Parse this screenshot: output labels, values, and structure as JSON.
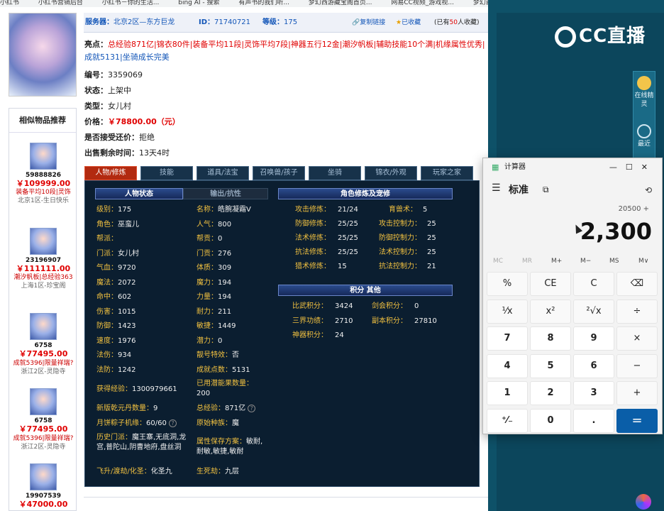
{
  "browser": {
    "tabs": [
      "小红书",
      "小红书营销后台",
      "小红书－你的生活...",
      "bing AI - 搜索",
      "有声书的我们听...",
      "梦幻西游藏宝阁首页...",
      "网易CC视频_游戏视...",
      "梦幻西游藏宝阁"
    ]
  },
  "product": {
    "server_label": "服务器：",
    "server": "北京2区—东方巨龙",
    "id_label": "ID：",
    "id": "71740721",
    "level_label": "等级：",
    "level": "175",
    "copy_link": "复制链接",
    "favorited": "已收藏",
    "fav_prefix": "(已有",
    "fav_count": "50",
    "fav_suffix": "人收藏)",
    "highlights_label": "亮点：",
    "highlights_line1": "总经验871亿|锦衣80件|装备平均11段|灵饰平均7段|神器五行12金|潮汐帆板|辅助技能10个满|机缘属性优秀|",
    "highlights_line2": "成就5131|坐骑成长完美",
    "number_label": "编号：",
    "number": "3359069",
    "status_label": "状态：",
    "status": "上架中",
    "type_label": "类型：",
    "type": "女儿村",
    "price_label": "价格：",
    "price": "￥78800.00（元）",
    "bargain_label": "是否接受还价：",
    "bargain": "拒绝",
    "remaining_label": "出售剩余时间：",
    "remaining": "13天4时"
  },
  "recommend": {
    "title": "相似物品推荐",
    "items": [
      {
        "id": "59888826",
        "price": "￥109999.00",
        "tag": "装备平均10段|灵饰",
        "server": "北京1区-生日快乐"
      },
      {
        "id": "23196907",
        "price": "￥111111.00",
        "tag": "潮汐帆板|总经验363",
        "server": "上海1区-珍宝阁"
      },
      {
        "id": "6758",
        "price": "￥77495.00",
        "tag": "成就5396|限量祥瑞?",
        "server": "浙江2区-灵隐寺"
      },
      {
        "id": "6758",
        "price": "￥77495.00",
        "tag": "成就5396|限量祥瑞?",
        "server": "浙江2区-灵隐寺"
      },
      {
        "id": "19907539",
        "price": "￥47000.00",
        "tag": "",
        "server": ""
      }
    ]
  },
  "tabs": [
    "人物/修炼",
    "技能",
    "道具/法宝",
    "召唤兽/孩子",
    "坐骑",
    "锦衣/外观",
    "玩家之家"
  ],
  "panel": {
    "char_status": "人物状态",
    "output_resist": "输出/抗性",
    "cultivation": "角色修炼及宠修",
    "points_other": "积分 其他",
    "left_fields": [
      {
        "k": "级别：",
        "v": "175"
      },
      {
        "k": "角色：",
        "v": "巫蛮儿"
      },
      {
        "k": "帮派：",
        "v": ""
      },
      {
        "k": "门派：",
        "v": "女儿村"
      },
      {
        "k": "气血：",
        "v": "9720"
      },
      {
        "k": "魔法：",
        "v": "2072"
      },
      {
        "k": "命中：",
        "v": "602"
      },
      {
        "k": "伤害：",
        "v": "1015"
      },
      {
        "k": "防御：",
        "v": "1423"
      },
      {
        "k": "速度：",
        "v": "1976"
      },
      {
        "k": "法伤：",
        "v": "934"
      },
      {
        "k": "法防：",
        "v": "1242"
      }
    ],
    "mid_fields": [
      {
        "k": "名称：",
        "v": "皓腕凝霜V"
      },
      {
        "k": "人气：",
        "v": "800"
      },
      {
        "k": "帮贡：",
        "v": "0"
      },
      {
        "k": "门贡：",
        "v": "276"
      },
      {
        "k": "体质：",
        "v": "309"
      },
      {
        "k": "魔力：",
        "v": "194"
      },
      {
        "k": "力量：",
        "v": "194"
      },
      {
        "k": "耐力：",
        "v": "211"
      },
      {
        "k": "敏捷：",
        "v": "1449"
      },
      {
        "k": "潜力：",
        "v": "0"
      },
      {
        "k": "靓号特效：",
        "v": "否"
      },
      {
        "k": "成就点数：",
        "v": "5131"
      }
    ],
    "exp_label": "获得经验：",
    "exp": "1300979661",
    "potential_label": "已用潜能果数量：",
    "potential": "200",
    "qiankun_label": "新版乾元丹数量：",
    "qiankun": "9",
    "total_exp_label": "总经验：",
    "total_exp": "871亿",
    "moon_label": "月饼粽子机缘：",
    "moon": "60/60",
    "race_label": "原始种族：",
    "race": "魔",
    "history_label": "历史门派：",
    "history": "魔王寨,无底洞,龙宫,普陀山,阴曹地府,盘丝洞",
    "attr_label": "属性保存方案：",
    "attr": "敏耐,耐敏,敏捷,敏耐",
    "fly_label": "飞升/渡劫/化圣：",
    "fly": "化圣九",
    "life_label": "生死劫：",
    "life": "九层",
    "cult_rows": [
      {
        "a": "攻击修炼：",
        "av": "21/24",
        "b": "育兽术：",
        "bv": "5"
      },
      {
        "a": "防御修炼：",
        "av": "25/25",
        "b": "攻击控制力：",
        "bv": "25"
      },
      {
        "a": "法术修炼：",
        "av": "25/25",
        "b": "防御控制力：",
        "bv": "25"
      },
      {
        "a": "抗法修炼：",
        "av": "25/25",
        "b": "法术控制力：",
        "bv": "25"
      },
      {
        "a": "猎术修炼：",
        "av": "15",
        "b": "抗法控制力：",
        "bv": "21"
      }
    ],
    "score_rows": [
      {
        "a": "比武积分：",
        "av": "3424",
        "b": "剑会积分：",
        "bv": "0"
      },
      {
        "a": "三界功绩：",
        "av": "2710",
        "b": "副本积分：",
        "bv": "27810"
      },
      {
        "a": "神器积分：",
        "av": "24",
        "b": "",
        "bv": ""
      }
    ]
  },
  "cc": {
    "logo": "CC直播",
    "side1": "在线精灵",
    "side2": "最近"
  },
  "calculator": {
    "title": "计算器",
    "mode": "标准",
    "expression": "20500 +",
    "display": "2,300",
    "memory": [
      "MC",
      "MR",
      "M+",
      "M−",
      "MS",
      "M∨"
    ],
    "keys": [
      "%",
      "CE",
      "C",
      "⌫",
      "¹⁄x",
      "x²",
      "²√x",
      "÷",
      "7",
      "8",
      "9",
      "×",
      "4",
      "5",
      "6",
      "−",
      "1",
      "2",
      "3",
      "+",
      "⁺⁄₋",
      "0",
      ".",
      "="
    ]
  }
}
